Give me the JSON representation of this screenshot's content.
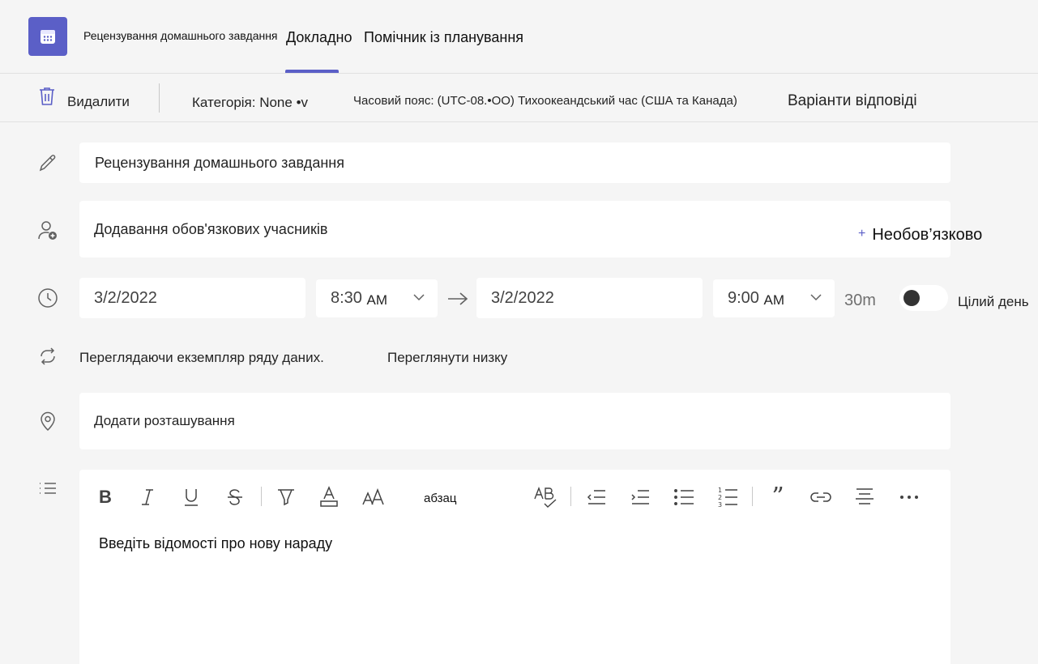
{
  "header": {
    "meeting_title": "Рецензування домашнього завдання",
    "tabs": [
      {
        "label": "Докладно",
        "selected": true
      },
      {
        "label": "Помічник із планування",
        "selected": false
      }
    ],
    "accent_color": "#5b5fc7",
    "app_icon": "calendar-icon"
  },
  "toolbar": {
    "delete_label": "Видалити",
    "category_label": "Категорія: None •v",
    "timezone_label": "Часовий пояс: (UTC-08.•OO) Тихоокеандський час (США та Канада)",
    "response_options_label": "Варіанти відповіді"
  },
  "form": {
    "title_value": "Рецензування домашнього завдання",
    "attendees_placeholder": "Додавання обов'язкових учасників",
    "optional_label": "Необов’язково",
    "optional_prefix": "+",
    "start_date": "3/2/2022",
    "start_time": "8:30",
    "start_ampm": "AM",
    "end_date": "3/2/2022",
    "end_time": "9:00",
    "end_ampm": "AM",
    "duration": "30m",
    "all_day_label": "Цілий день",
    "all_day_on": false,
    "series_text": "Переглядаючи екземпляр ряду даних.",
    "series_link": "Переглянути низку",
    "location_placeholder": "Додати розташування",
    "editor_placeholder": "Введіть відомості про нову нараду",
    "paragraph_label": "абзац"
  },
  "editor_tools": [
    "bold-icon",
    "italic-icon",
    "underline-icon",
    "strikethrough-icon",
    "highlight-icon",
    "font-color-icon",
    "font-size-icon",
    "paragraph-style",
    "spellcheck-icon",
    "decrease-indent-icon",
    "increase-indent-icon",
    "bulleted-list-icon",
    "numbered-list-icon",
    "quote-icon",
    "link-icon",
    "align-icon",
    "more-options-icon"
  ],
  "row_icons": [
    "pencil-icon",
    "add-person-icon",
    "clock-icon",
    "repeat-icon",
    "location-pin-icon",
    "details-list-icon"
  ]
}
